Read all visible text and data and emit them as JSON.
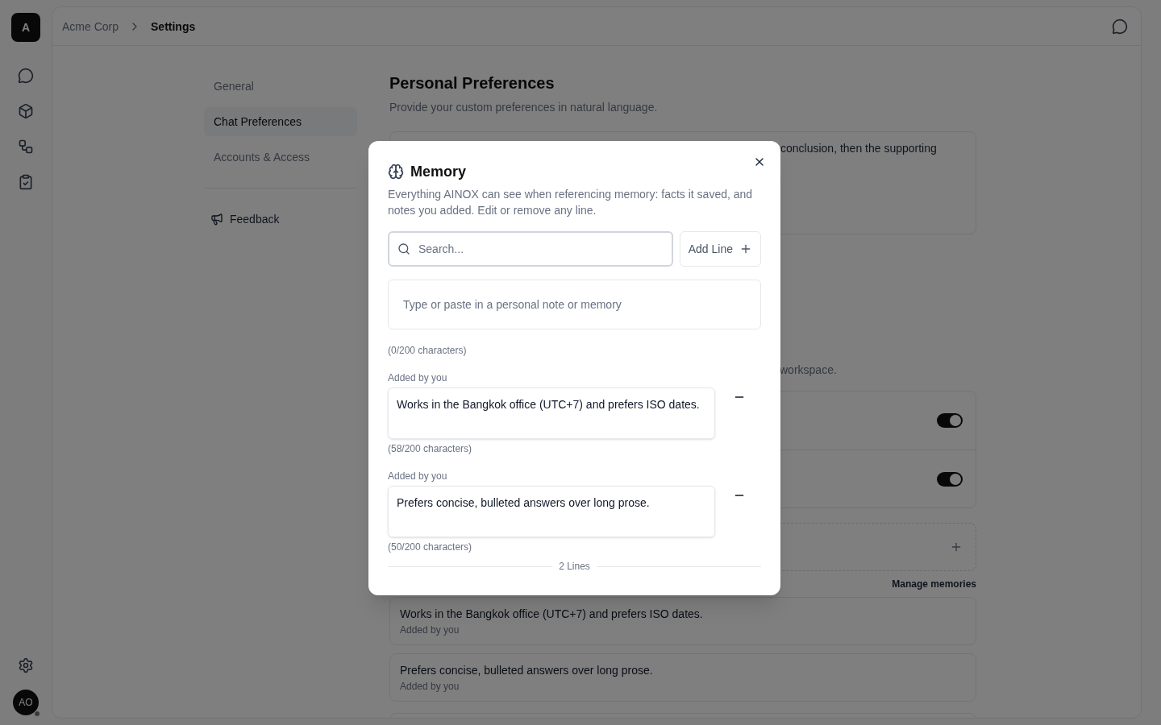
{
  "rail": {
    "logo": "A",
    "avatar": "AO",
    "online": true
  },
  "breadcrumb": [
    "Acme Corp",
    "Settings"
  ],
  "settings_nav": [
    {
      "label": "General",
      "selected": false
    },
    {
      "label": "Chat Preferences",
      "selected": true
    },
    {
      "label": "Accounts & Access",
      "selected": false
    }
  ],
  "feedback": "Feedback",
  "preferences": {
    "title": "Personal Preferences",
    "subtitle": "Provide your custom preferences in natural language.",
    "textarea_visible_text": "conclusion, then the supporting"
  },
  "memory_section": {
    "description_visible_text": "workspace.",
    "toggles": [
      {
        "on": true
      },
      {
        "on": true
      }
    ],
    "manage_link": "Manage memories",
    "memories": [
      {
        "text": "Works in the Bangkok office (UTC+7) and prefers ISO dates.",
        "source": "Added by you"
      },
      {
        "text": "Prefers concise, bulleted answers over long prose.",
        "source": "Added by you"
      }
    ]
  },
  "modal": {
    "title": "Memory",
    "description": "Everything AINOX can see when referencing memory: facts it saved, and notes you added. Edit or remove any line.",
    "search_placeholder": "Search...",
    "add_button": "Add Line",
    "note_placeholder": "Type or paste in a personal note or memory",
    "note_counter": "(0/200 characters)",
    "lines": [
      {
        "source": "Added by you",
        "text": "Works in the Bangkok office (UTC+7) and prefers ISO dates.",
        "counter": "(58/200 characters)"
      },
      {
        "source": "Added by you",
        "text": "Prefers concise, bulleted answers over long prose.",
        "counter": "(50/200 characters)"
      }
    ],
    "footer": "2 Lines"
  }
}
